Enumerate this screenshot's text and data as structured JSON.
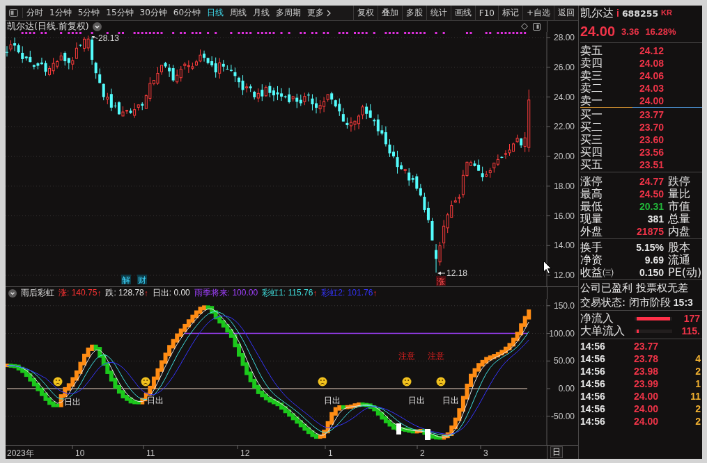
{
  "toolbar": {
    "periods": [
      {
        "label": "分时",
        "selected": false,
        "kind": "period"
      },
      {
        "label": "1分钟",
        "selected": false,
        "kind": "period"
      },
      {
        "label": "5分钟",
        "selected": false,
        "kind": "period"
      },
      {
        "label": "15分钟",
        "selected": false,
        "kind": "period"
      },
      {
        "label": "30分钟",
        "selected": false,
        "kind": "period"
      },
      {
        "label": "60分钟",
        "selected": false,
        "kind": "period"
      },
      {
        "label": "日线",
        "selected": true,
        "kind": "period"
      },
      {
        "label": "周线",
        "selected": false,
        "kind": "period"
      },
      {
        "label": "月线",
        "selected": false,
        "kind": "period"
      },
      {
        "label": "多周期",
        "selected": false,
        "kind": "period"
      },
      {
        "label": "更多",
        "selected": false,
        "kind": "menu"
      }
    ],
    "actions": [
      "复权",
      "叠加",
      "多股",
      "统计",
      "画线",
      "F10",
      "标记",
      "+自选",
      "返回"
    ]
  },
  "main_chart": {
    "title": "凯尔达(日线.前复权)",
    "price_axis": [
      "28.00",
      "26.00",
      "24.00",
      "22.00",
      "20.00",
      "18.00",
      "16.00",
      "14.00",
      "12.00"
    ],
    "high_label": "28.13",
    "low_label": "12.18",
    "event_badges": [
      {
        "text": "解"
      },
      {
        "text": "财"
      }
    ],
    "limit_badge": "涨"
  },
  "indicator": {
    "name": "雨后彩虹",
    "legend": [
      {
        "label": "涨:",
        "value": "140.75",
        "arrow": "↑",
        "color": "#ff3333"
      },
      {
        "label": "跌:",
        "value": "128.78",
        "arrow": "↑",
        "color": "#e8e8e8"
      },
      {
        "label": "日出:",
        "value": "0.00",
        "color": "#e8e8e8"
      },
      {
        "label": "雨季将来:",
        "value": "100.00",
        "color": "#a040ff"
      },
      {
        "label": "彩虹1:",
        "value": "115.76",
        "arrow": "↑",
        "color": "#40e0e0"
      },
      {
        "label": "彩虹2:",
        "value": "101.76",
        "arrow": "↑",
        "color": "#3434ff"
      }
    ],
    "axis": [
      "150.0",
      "100.00",
      "50.00",
      "0.00",
      "-50.00"
    ],
    "sunrise_labels": [
      "日出",
      "日出",
      "日出",
      "日出",
      "日出"
    ],
    "warnings": [
      "注意",
      "注意"
    ]
  },
  "time_axis": {
    "labels": [
      "2023年",
      "10",
      "11",
      "12",
      "1",
      "2",
      "3"
    ],
    "period_button": "日"
  },
  "quote_panel": {
    "name": "凯尔达",
    "info_mark": "i",
    "code": "688255",
    "tag": "KR",
    "price": "24.00",
    "change": "3.36",
    "change_pct": "16.28%",
    "asks": [
      {
        "label": "卖五",
        "price": "24.12"
      },
      {
        "label": "卖四",
        "price": "24.08"
      },
      {
        "label": "卖三",
        "price": "24.06"
      },
      {
        "label": "卖二",
        "price": "24.03"
      },
      {
        "label": "卖一",
        "price": "24.00"
      }
    ],
    "bids": [
      {
        "label": "买一",
        "price": "23.77"
      },
      {
        "label": "买二",
        "price": "23.70"
      },
      {
        "label": "买三",
        "price": "23.60"
      },
      {
        "label": "买四",
        "price": "23.56"
      },
      {
        "label": "买五",
        "price": "23.51"
      }
    ],
    "stats": [
      {
        "label": "涨停",
        "value": "24.77",
        "color": "#f03448",
        "label_2": "跌停"
      },
      {
        "label": "最高",
        "value": "24.50",
        "color": "#f03448",
        "label_2": "量比"
      },
      {
        "label": "最低",
        "value": "20.31",
        "color": "#22b83a",
        "label_2": "市值"
      },
      {
        "label": "现量",
        "value": "381",
        "color": "#e6e6e6",
        "label_2": "总量"
      },
      {
        "label": "外盘",
        "value": "21875",
        "color": "#f03448",
        "label_2": "内盘"
      }
    ],
    "fundamentals": [
      {
        "label": "换手",
        "value": "5.15%",
        "label_2": "股本"
      },
      {
        "label": "净资",
        "value": "9.69",
        "label_2": "流通"
      },
      {
        "label": "收益㈢",
        "value": "0.150",
        "label_2": "PE(动)"
      }
    ],
    "company_note": "公司已盈利 投票权无差",
    "trade_status": {
      "label": "交易状态: 闭市阶段",
      "time": "15:3"
    },
    "flows": [
      {
        "label": "净流入",
        "level": 1,
        "value": "177"
      },
      {
        "label": "大单流入",
        "level": 0.07,
        "value": "115."
      }
    ],
    "ticks": [
      {
        "time": "14:56",
        "price": "23.77"
      },
      {
        "time": "14:56",
        "price": "23.78",
        "volume": "4"
      },
      {
        "time": "14:56",
        "price": "23.98",
        "volume": "2"
      },
      {
        "time": "14:56",
        "price": "23.99",
        "volume": "1"
      },
      {
        "time": "14:56",
        "price": "24.00",
        "volume": "11"
      },
      {
        "time": "14:56",
        "price": "24.00",
        "volume": "2"
      },
      {
        "time": "14:56",
        "price": "24.00",
        "volume": "2"
      }
    ]
  }
}
